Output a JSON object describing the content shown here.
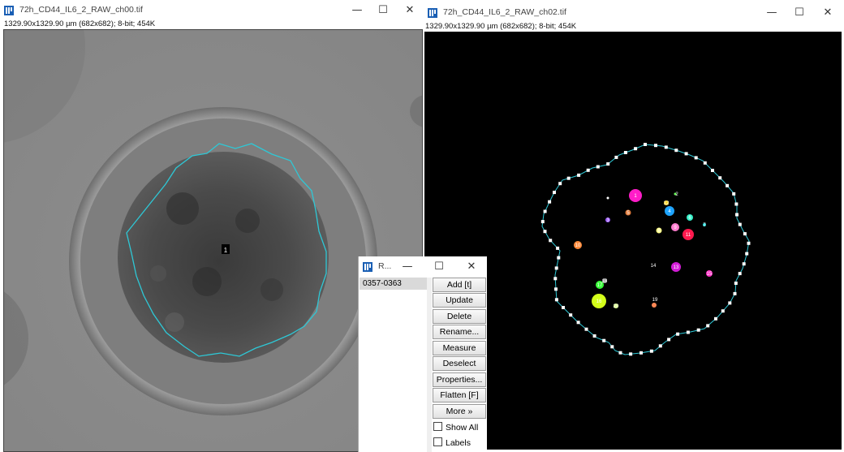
{
  "window1": {
    "title": "72h_CD44_IL6_2_RAW_ch00.tif",
    "info": "1329.90x1329.90 µm (682x682); 8-bit; 454K",
    "roi_label": "1",
    "controls": {
      "minimize": "—",
      "maximize": "☐",
      "close": "✕"
    }
  },
  "window2": {
    "title": "72h_CD44_IL6_2_RAW_ch02.tif",
    "info": "1329.90x1329.90 µm (682x682); 8-bit; 454K",
    "controls": {
      "minimize": "—",
      "maximize": "☐",
      "close": "✕"
    },
    "cell_labels": [
      "1",
      "2",
      "3",
      "4",
      "5",
      "6",
      "7",
      "8",
      "9",
      "10",
      "11",
      "12",
      "13",
      "14",
      "15",
      "16",
      "17",
      "18",
      "19",
      "20"
    ]
  },
  "roi_manager": {
    "title": "R...",
    "controls": {
      "minimize": "—",
      "maximize": "☐",
      "close": "✕"
    },
    "list_items": [
      "0357-0363"
    ],
    "buttons": [
      "Add [t]",
      "Update",
      "Delete",
      "Rename...",
      "Measure",
      "Deselect",
      "Properties...",
      "Flatten [F]",
      "More »"
    ],
    "checkboxes": [
      {
        "label": "Show All",
        "checked": false
      },
      {
        "label": "Labels",
        "checked": false
      }
    ]
  },
  "icons": {
    "app": "imagej-icon"
  },
  "colors": {
    "roi_outline": "#2ec8d6",
    "brightfield_bg": "#8d8d8d",
    "fluorescence_bg": "#000000"
  }
}
